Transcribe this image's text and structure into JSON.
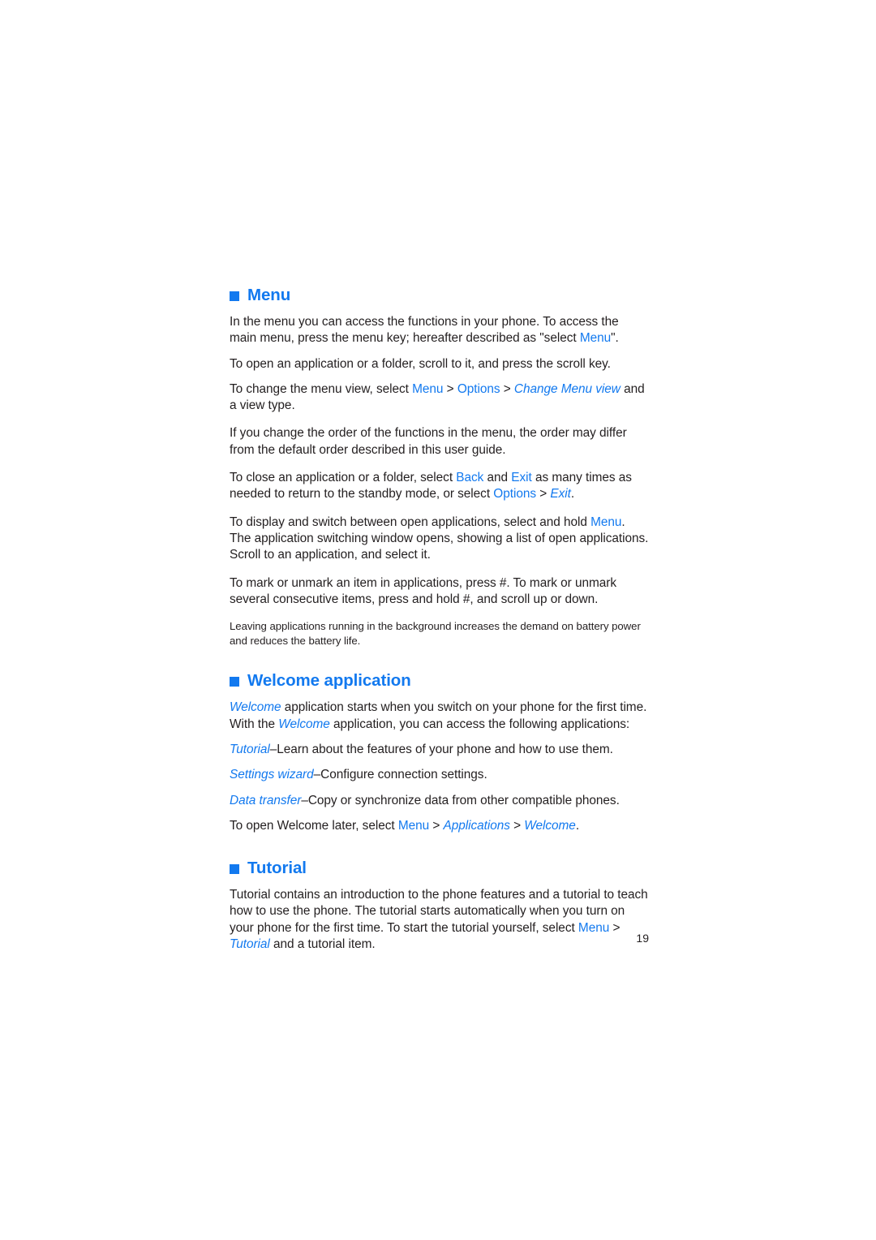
{
  "document": {
    "page_number": "19",
    "accent_color": "#1279ef",
    "text_color": "#231f20",
    "background_color": "#ffffff"
  },
  "sections": [
    {
      "id": "menu",
      "heading": "Menu",
      "bullet_icon": "filled-square-bullet-icon",
      "paragraphs": [
        {
          "id": "menu-p1",
          "parts": [
            {
              "text": "In the menu you can access the functions in your phone. To access the main menu, press the menu key; hereafter described as \"select ",
              "style": "plain"
            },
            {
              "text": "Menu",
              "style": "ui"
            },
            {
              "text": "\".",
              "style": "plain"
            }
          ]
        },
        {
          "id": "menu-p2",
          "parts": [
            {
              "text": "To open an application or a folder, scroll to it, and press the scroll key.",
              "style": "plain"
            }
          ]
        },
        {
          "id": "menu-p3",
          "parts": [
            {
              "text": "To change the menu view, select ",
              "style": "plain"
            },
            {
              "text": "Menu",
              "style": "ui"
            },
            {
              "text": " > ",
              "style": "sep"
            },
            {
              "text": "Options",
              "style": "ui"
            },
            {
              "text": " > ",
              "style": "sep"
            },
            {
              "text": "Change Menu view",
              "style": "item"
            },
            {
              "text": " and a view type.",
              "style": "plain"
            }
          ]
        },
        {
          "id": "menu-p4",
          "parts": [
            {
              "text": "If you change the order of the functions in the menu, the order may differ from the default order described in this user guide.",
              "style": "plain"
            }
          ]
        },
        {
          "id": "menu-p5",
          "parts": [
            {
              "text": "To close an application or a folder, select ",
              "style": "plain"
            },
            {
              "text": "Back",
              "style": "ui"
            },
            {
              "text": " and ",
              "style": "plain"
            },
            {
              "text": "Exit",
              "style": "ui"
            },
            {
              "text": " as many times as needed to return to the standby mode, or select ",
              "style": "plain"
            },
            {
              "text": "Options",
              "style": "ui"
            },
            {
              "text": " > ",
              "style": "sep"
            },
            {
              "text": "Exit",
              "style": "item"
            },
            {
              "text": ".",
              "style": "plain"
            }
          ]
        },
        {
          "id": "menu-p6",
          "parts": [
            {
              "text": "To display and switch between open applications, select and hold ",
              "style": "plain"
            },
            {
              "text": "Menu",
              "style": "ui"
            },
            {
              "text": ". The application switching window opens, showing a list of open applications. Scroll to an application, and select it.",
              "style": "plain"
            }
          ]
        },
        {
          "id": "menu-p7",
          "parts": [
            {
              "text": "To mark or unmark an item in applications, press #. To mark or unmark several consecutive items, press and hold #, and scroll up or down.",
              "style": "plain"
            }
          ]
        }
      ],
      "note": "Leaving applications running in the background increases the demand on battery power and reduces the battery life."
    },
    {
      "id": "welcome",
      "heading": "Welcome application",
      "bullet_icon": "filled-square-bullet-icon",
      "paragraphs": [
        {
          "id": "welcome-p1",
          "parts": [
            {
              "text": "Welcome",
              "style": "item"
            },
            {
              "text": " application starts when you switch on your phone for the first time. With the ",
              "style": "plain"
            },
            {
              "text": "Welcome",
              "style": "item"
            },
            {
              "text": " application, you can access the following applications:",
              "style": "plain"
            }
          ]
        },
        {
          "id": "welcome-p2",
          "parts": [
            {
              "text": "Tutorial",
              "style": "item"
            },
            {
              "text": "–Learn about the features of your phone and how to use them.",
              "style": "plain"
            }
          ]
        },
        {
          "id": "welcome-p3",
          "parts": [
            {
              "text": "Settings wizard",
              "style": "item"
            },
            {
              "text": "–Configure connection settings.",
              "style": "plain"
            }
          ]
        },
        {
          "id": "welcome-p4",
          "parts": [
            {
              "text": "Data transfer",
              "style": "item"
            },
            {
              "text": "–Copy or synchronize data from other compatible phones.",
              "style": "plain"
            }
          ]
        },
        {
          "id": "welcome-p5",
          "parts": [
            {
              "text": "To open Welcome later, select ",
              "style": "plain"
            },
            {
              "text": "Menu",
              "style": "ui"
            },
            {
              "text": " > ",
              "style": "sep"
            },
            {
              "text": "Applications",
              "style": "item"
            },
            {
              "text": " > ",
              "style": "sep"
            },
            {
              "text": "Welcome",
              "style": "item"
            },
            {
              "text": ".",
              "style": "plain"
            }
          ]
        }
      ]
    },
    {
      "id": "tutorial",
      "heading": "Tutorial",
      "bullet_icon": "filled-square-bullet-icon",
      "paragraphs": [
        {
          "id": "tutorial-p1",
          "parts": [
            {
              "text": "Tutorial contains an introduction to the phone features and a tutorial to teach how to use the phone. The tutorial starts automatically when you turn on your phone for the first time. To start the tutorial yourself, select ",
              "style": "plain"
            },
            {
              "text": "Menu",
              "style": "ui"
            },
            {
              "text": " > ",
              "style": "sep"
            },
            {
              "text": "Tutorial",
              "style": "item"
            },
            {
              "text": " and a tutorial item.",
              "style": "plain"
            }
          ]
        }
      ]
    }
  ]
}
